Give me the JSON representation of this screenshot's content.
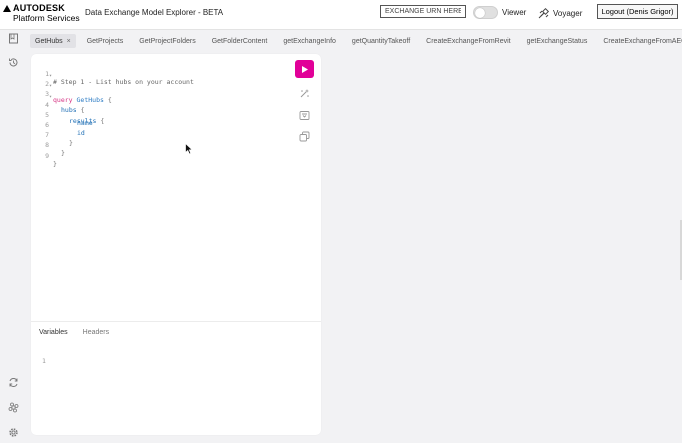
{
  "header": {
    "logo_line1": "AUTODESK",
    "logo_line2": "Platform Services",
    "app_title": "Data Exchange Model Explorer - BETA",
    "urn_placeholder": "EXCHANGE URN HERE",
    "viewer_label": "Viewer",
    "voyager_label": "Voyager",
    "logout_label": "Logout (Denis Grigor)"
  },
  "sidebar": {
    "icons": [
      "docs-icon",
      "history-icon",
      "refetch-icon",
      "shortcut-icon",
      "settings-icon"
    ]
  },
  "tabs": [
    {
      "label": "GetHubs",
      "active": true,
      "close": "×"
    },
    {
      "label": "GetProjects"
    },
    {
      "label": "GetProjectFolders"
    },
    {
      "label": "GetFolderContent"
    },
    {
      "label": "getExchangeInfo"
    },
    {
      "label": "getQuantityTakeoff"
    },
    {
      "label": "CreateExchangeFromRevit"
    },
    {
      "label": "getExchangeStatus"
    },
    {
      "label": "CreateExchangeFromAEC"
    }
  ],
  "editor": {
    "lines": [
      {
        "n": "1",
        "text": "# Step 1 - List hubs on your account"
      },
      {
        "n": "2",
        "kw": "query",
        "name": "GetHubs",
        "punc": "{"
      },
      {
        "n": "3",
        "field": "hubs",
        "punc": "{"
      },
      {
        "n": "4",
        "field": "results",
        "punc": "{"
      },
      {
        "n": "5",
        "field": "name"
      },
      {
        "n": "6",
        "field": "id"
      },
      {
        "n": "7",
        "punc": "}"
      },
      {
        "n": "8",
        "punc": "}"
      },
      {
        "n": "9",
        "punc": "}"
      }
    ],
    "vars_tabs": [
      "Variables",
      "Headers"
    ],
    "vars_line": "1"
  },
  "colors": {
    "run_button": "#e10098",
    "keyword": "#d63384",
    "definition": "#2b7bc4"
  }
}
